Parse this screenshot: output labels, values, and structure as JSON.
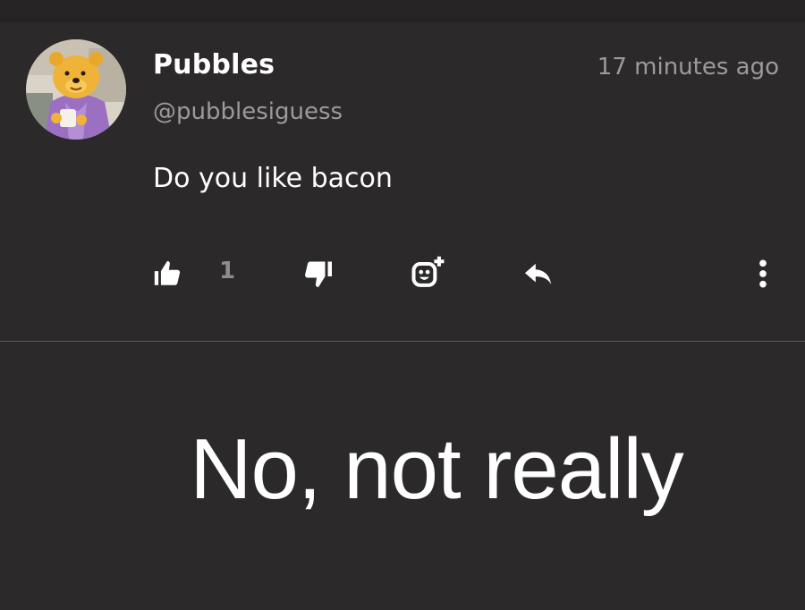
{
  "comment": {
    "username": "Pubbles",
    "handle": "@pubblesiguess",
    "timestamp": "17 minutes ago",
    "text": "Do you like bacon",
    "like_count": "1"
  },
  "actions": {
    "like_icon": "thumbs-up-icon",
    "dislike_icon": "thumbs-down-icon",
    "reaction_icon": "add-emoji-icon",
    "reply_icon": "reply-icon",
    "more_icon": "more-vertical-icon"
  },
  "caption": "No, not really",
  "colors": {
    "background": "#2b292a",
    "primary_text": "#ffffff",
    "secondary_text": "#9d9a9b"
  }
}
